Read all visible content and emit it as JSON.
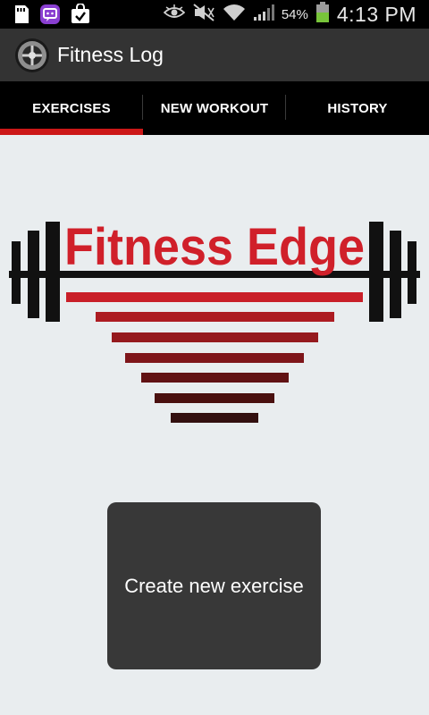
{
  "status_bar": {
    "battery_percent": "54%",
    "time": "4:13 PM",
    "icons": [
      "sd-card-icon",
      "chat-app-icon",
      "shopping-bag-icon",
      "eye-icon",
      "mute-icon",
      "wifi-icon",
      "signal-icon",
      "battery-icon"
    ]
  },
  "action_bar": {
    "title": "Fitness Log"
  },
  "tabs": [
    {
      "label": "EXERCISES",
      "selected": true
    },
    {
      "label": "NEW WORKOUT",
      "selected": false
    },
    {
      "label": "HISTORY",
      "selected": false
    }
  ],
  "logo": {
    "text": "Fitness Edge",
    "brand_color": "#d0202a"
  },
  "main": {
    "create_button_label": "Create new exercise"
  },
  "colors": {
    "accent": "#cc1818",
    "background": "#e9edef",
    "action_bar": "#333333",
    "tab_bar": "#000000",
    "button": "#383838"
  }
}
